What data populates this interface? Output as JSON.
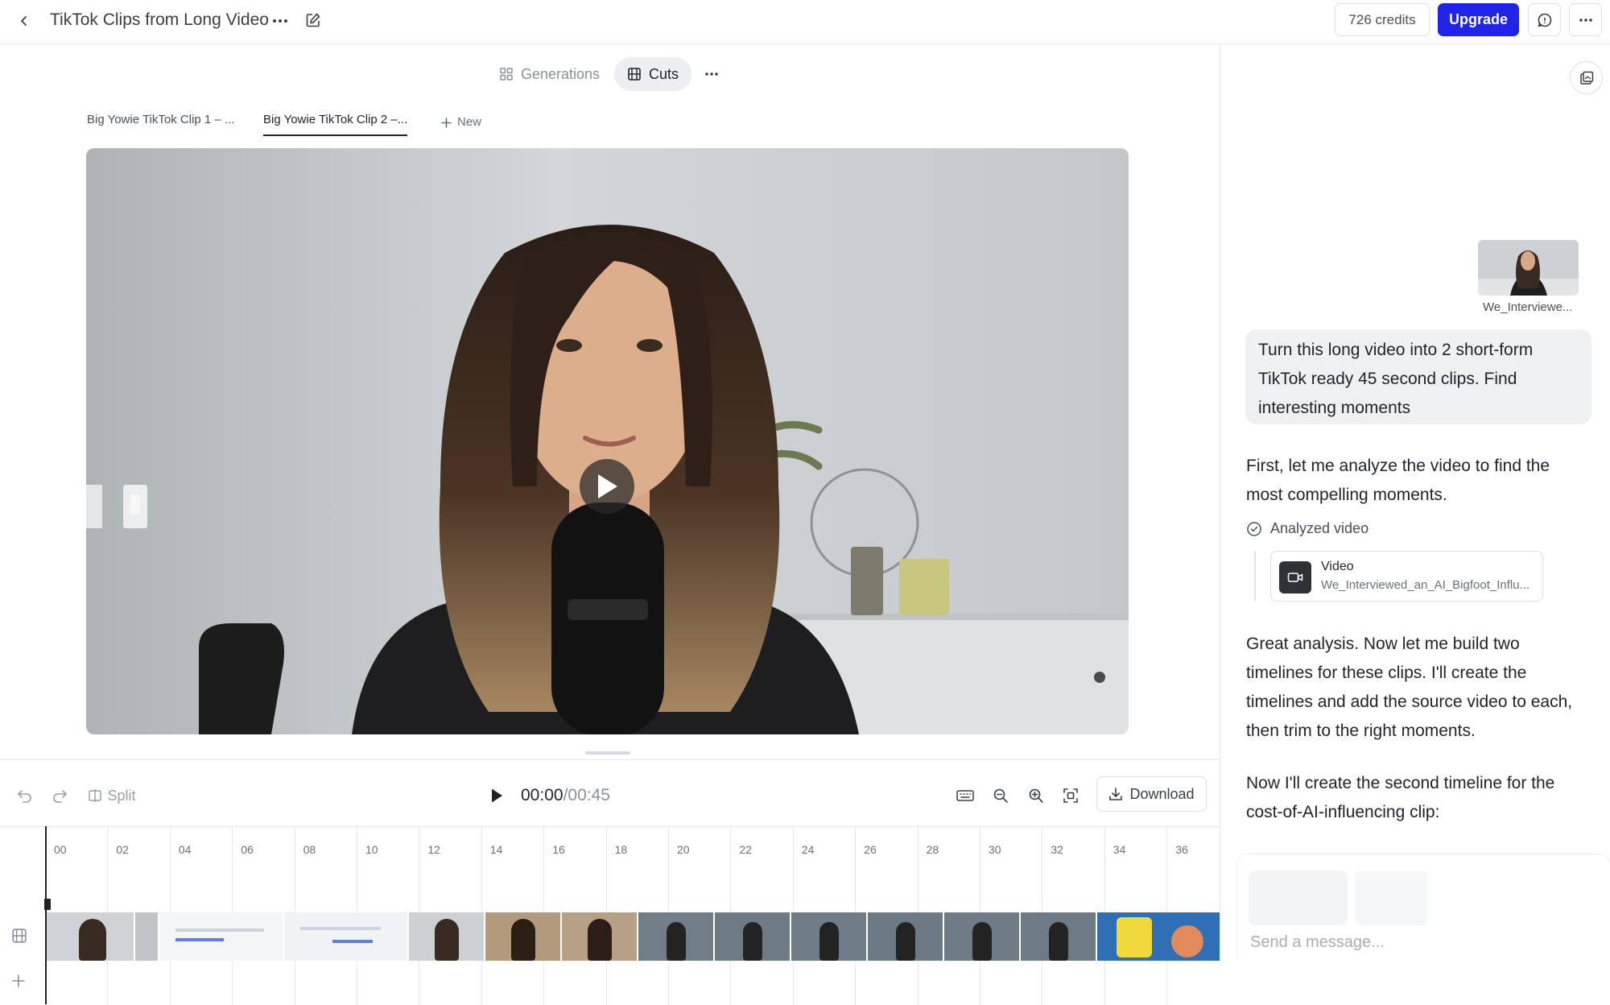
{
  "header": {
    "title": "TikTok Clips from Long Video",
    "credits": "726 credits",
    "upgrade_label": "Upgrade"
  },
  "views": {
    "generations_label": "Generations",
    "cuts_label": "Cuts",
    "active": "Cuts"
  },
  "tabs": [
    {
      "label": "Big Yowie TikTok Clip 1 – ...",
      "active": false
    },
    {
      "label": "Big Yowie TikTok Clip 2 –...",
      "active": true
    }
  ],
  "new_tab_label": "New",
  "timeline": {
    "split_label": "Split",
    "current_time": "00:00",
    "total_time": "/00:45",
    "download_label": "Download",
    "ticks": [
      "00",
      "02",
      "04",
      "06",
      "08",
      "10",
      "12",
      "14",
      "16",
      "18",
      "20",
      "22",
      "24",
      "26",
      "28",
      "30",
      "32",
      "34",
      "36"
    ]
  },
  "chat": {
    "attachment_name": "We_Interviewe...",
    "user_message": "Turn this long video into 2 short-form TikTok ready 45 second clips. Find interesting moments",
    "assistant_1": "First, let me analyze the video to find the most compelling moments.",
    "analyzed_label": "Analyzed video",
    "video_card_title": "Video",
    "video_card_subtitle": "We_Interviewed_an_AI_Bigfoot_Influ...",
    "assistant_2": "Great analysis. Now let me build two timelines for these clips. I'll create the timelines and add the source video to each, then trim to the right moments.",
    "assistant_3": "Now I'll create the second timeline for the cost-of-AI-influencing clip:",
    "composer_placeholder": "Send a message..."
  },
  "colors": {
    "accent": "#1f24e6",
    "text": "#1f2329",
    "muted": "#8a9097",
    "border": "#e6e8eb"
  },
  "icons": [
    "back-icon",
    "more-icon",
    "edit-icon",
    "chat-icon",
    "grid-icon",
    "film-icon",
    "plus-icon",
    "play-icon",
    "undo-icon",
    "redo-icon",
    "split-icon",
    "keyboard-icon",
    "zoom-out-icon",
    "zoom-in-icon",
    "fit-icon",
    "download-icon",
    "panel-icon",
    "check-circle-icon",
    "camera-icon"
  ]
}
